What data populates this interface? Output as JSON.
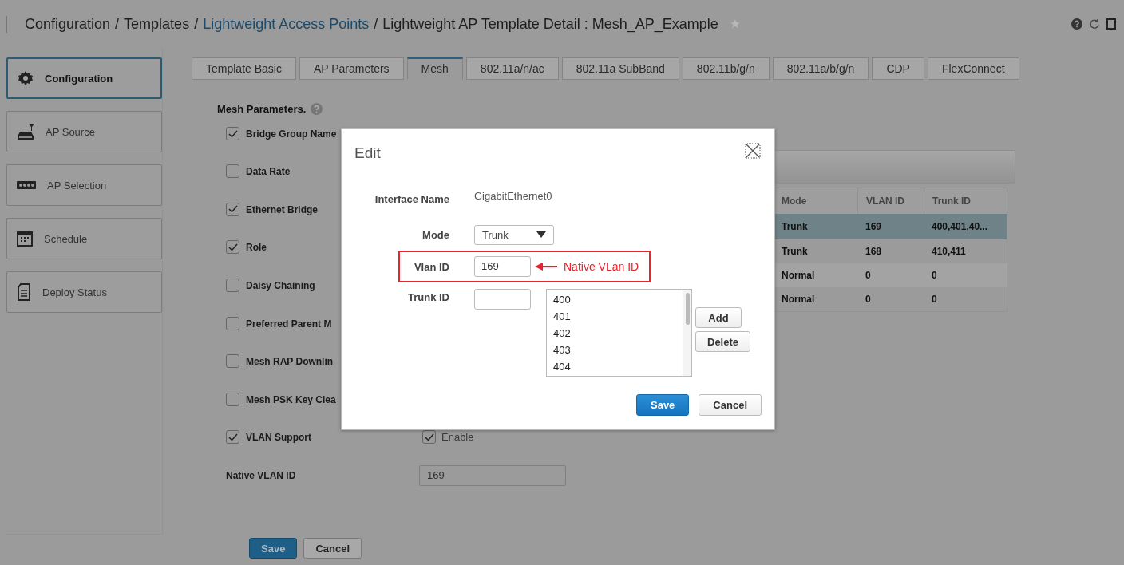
{
  "breadcrumb": [
    {
      "text": "Configuration",
      "link": false
    },
    {
      "separator": "/",
      "text": "Templates",
      "link": false
    },
    {
      "separator": "/",
      "text": "Lightweight Access Points",
      "link": true
    },
    {
      "separator": "/",
      "text": "Lightweight AP Template Detail : Mesh_AP_Example",
      "link": false
    }
  ],
  "sidebar": {
    "items": [
      {
        "label": "Configuration",
        "selected": true
      },
      {
        "label": "AP Source",
        "selected": false
      },
      {
        "label": "AP Selection",
        "selected": false
      },
      {
        "label": "Schedule",
        "selected": false
      },
      {
        "label": "Deploy Status",
        "selected": false
      }
    ]
  },
  "tabs": [
    {
      "label": "Template Basic",
      "selected": false
    },
    {
      "label": "AP Parameters",
      "selected": false
    },
    {
      "label": "Mesh",
      "selected": true
    },
    {
      "label": "802.11a/n/ac",
      "selected": false
    },
    {
      "label": "802.11a SubBand",
      "selected": false
    },
    {
      "label": "802.11b/g/n",
      "selected": false
    },
    {
      "label": "802.11a/b/g/n",
      "selected": false
    },
    {
      "label": "CDP",
      "selected": false
    },
    {
      "label": "FlexConnect",
      "selected": false
    }
  ],
  "form": {
    "title": "Mesh Parameters.",
    "rows": [
      {
        "kind": "check",
        "label": "Bridge Group Name",
        "checked": true
      },
      {
        "kind": "check",
        "label": "Data Rate",
        "checked": false
      },
      {
        "kind": "check",
        "label": "Ethernet Bridge",
        "checked": true
      },
      {
        "kind": "check",
        "label": "Role",
        "checked": true
      },
      {
        "kind": "check",
        "label": "Daisy Chaining",
        "checked": false
      },
      {
        "kind": "check",
        "label": "Preferred Parent M",
        "checked": false
      },
      {
        "kind": "check",
        "label": "Mesh RAP Downlin",
        "checked": false
      },
      {
        "kind": "check",
        "label": "Mesh PSK Key Clea",
        "checked": false
      },
      {
        "kind": "check",
        "label": "VLAN Support",
        "checked": true,
        "option": {
          "label": "Enable",
          "checked": true
        }
      },
      {
        "kind": "field",
        "label": "Native VLAN ID",
        "value": "169"
      }
    ],
    "buttons": [
      {
        "label": "Save",
        "primary": true
      },
      {
        "label": "Cancel",
        "primary": false
      }
    ]
  },
  "table": {
    "columns": [
      "Mode",
      "VLAN ID",
      "Trunk ID"
    ],
    "rows": [
      {
        "cells": [
          "Trunk",
          "169",
          "400,401,40..."
        ],
        "selected": true
      },
      {
        "cells": [
          "Trunk",
          "168",
          "410,411"
        ],
        "selected": false
      },
      {
        "cells": [
          "Normal",
          "0",
          "0"
        ],
        "selected": false
      },
      {
        "cells": [
          "Normal",
          "0",
          "0"
        ],
        "selected": false
      }
    ]
  },
  "dialog": {
    "title": "Edit",
    "interface_name_label": "Interface Name",
    "interface_name": "GigabitEthernet0",
    "mode_label": "Mode",
    "mode": "Trunk",
    "vlan_label": "Vlan ID",
    "vlan_id": "169",
    "annotation": "Native VLan ID",
    "trunk_label": "Trunk ID",
    "trunk_list": [
      "400",
      "401",
      "402",
      "403",
      "404"
    ],
    "list_buttons": [
      "Add",
      "Delete"
    ],
    "buttons": [
      {
        "label": "Save",
        "primary": true
      },
      {
        "label": "Cancel",
        "primary": false
      }
    ]
  }
}
